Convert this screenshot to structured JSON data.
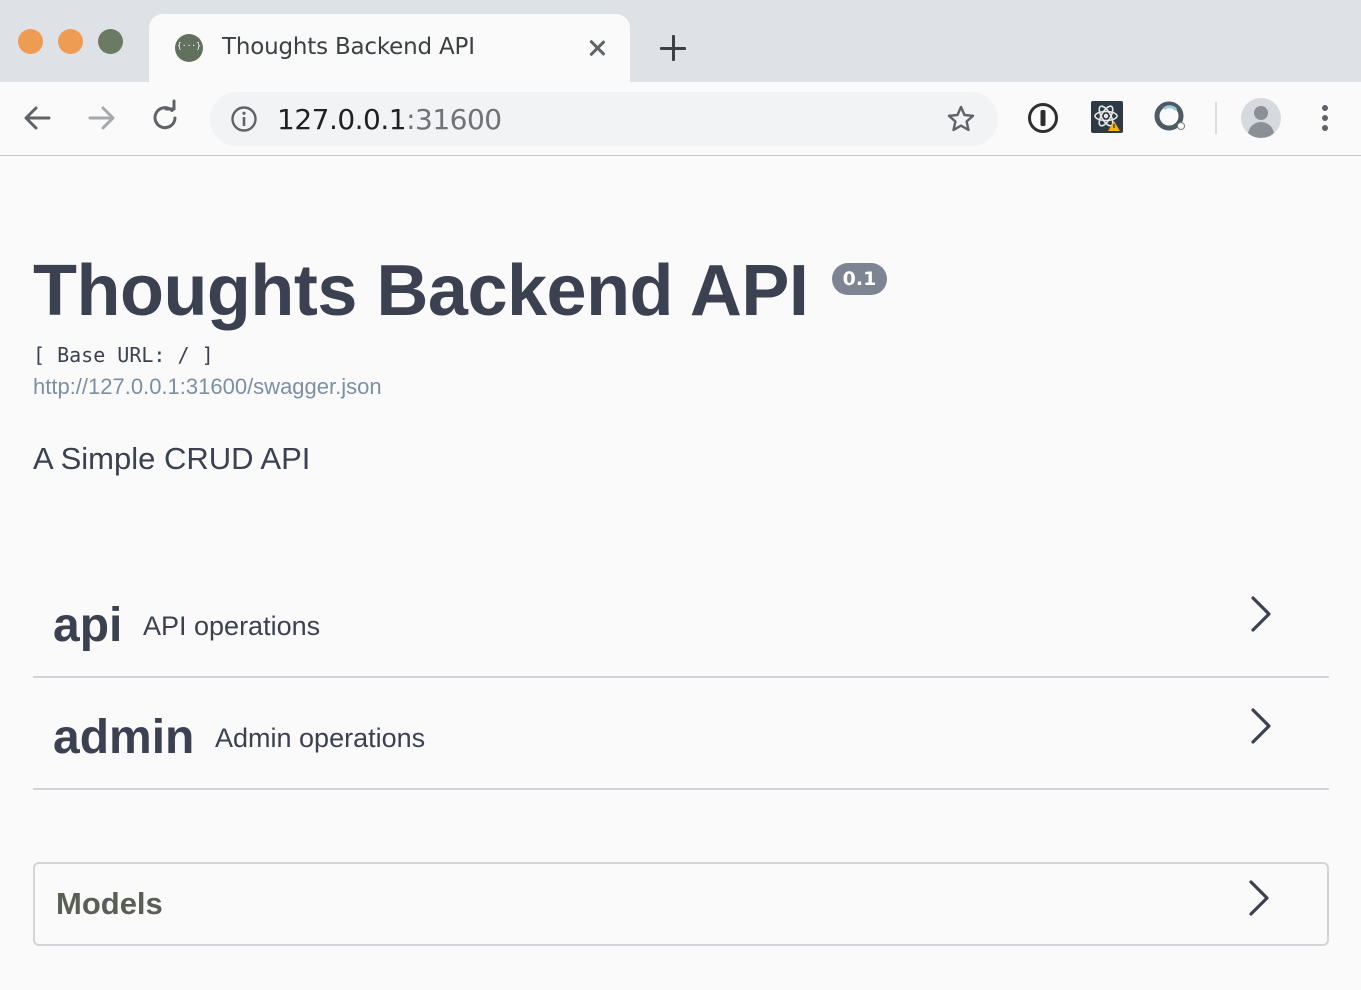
{
  "browser": {
    "tab_title": "Thoughts Backend API",
    "url_host": "127.0.0.1",
    "url_port": ":31600"
  },
  "api_info": {
    "title": "Thoughts Backend API",
    "version": "0.1",
    "base_url_text": "[ Base URL: / ]",
    "spec_url": "http://127.0.0.1:31600/swagger.json",
    "description": "A Simple CRUD API"
  },
  "tags": [
    {
      "name": "api",
      "description": "API operations"
    },
    {
      "name": "admin",
      "description": "Admin operations"
    }
  ],
  "models": {
    "title": "Models"
  },
  "colors": {
    "text": "#3b4151",
    "badge": "#7d8492",
    "link": "#7d8fa3",
    "tab_strip": "#dee1e6"
  }
}
